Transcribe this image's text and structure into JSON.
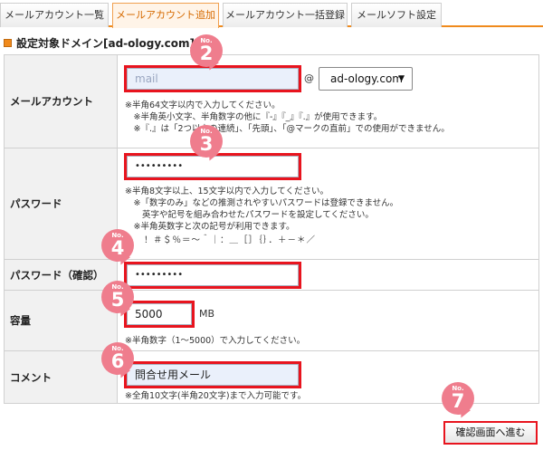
{
  "tabs": [
    {
      "label": "メールアカウント一覧",
      "active": false
    },
    {
      "label": "メールアカウント追加",
      "active": true
    },
    {
      "label": "メールアカウント一括登録",
      "active": false
    },
    {
      "label": "メールソフト設定",
      "active": false
    }
  ],
  "section_title": "設定対象ドメイン[ad-ology.com]",
  "account": {
    "label": "メールアカウント",
    "value": "mail",
    "at": "@",
    "domain": "ad-ology.com",
    "notes": [
      "※半角64文字以内で入力してください。",
      "　※半角英小文字、半角数字の他に『-』『_』『.』が使用できます。",
      "　※『.』は「2つ以上の連続」、「先頭」、「@マークの直前」での使用ができません。"
    ]
  },
  "password": {
    "label": "パスワード",
    "value": "•••••••••",
    "notes": [
      "※半角8文字以上、15文字以内で入力してください。",
      "　※「数字のみ」などの推測されやすいパスワードは登録できません。",
      "　　英字や記号を組み合わせたパスワードを設定してください。",
      "　※半角英数字と次の記号が利用できます。",
      "　　！＃＄％＝～＾｜：＿［］｛｝．＋－＊／"
    ]
  },
  "password_confirm": {
    "label": "パスワード（確認）",
    "value": "•••••••••"
  },
  "capacity": {
    "label": "容量",
    "value": "5000",
    "unit": "MB",
    "note": "※半角数字（1～5000）で入力してください。"
  },
  "comment": {
    "label": "コメント",
    "value": "問合せ用メール",
    "note": "※全角10文字(半角20文字)まで入力可能です。"
  },
  "submit_label": "確認画面へ進む",
  "badges": [
    {
      "no": "No.",
      "num": "2"
    },
    {
      "no": "No.",
      "num": "3"
    },
    {
      "no": "No.",
      "num": "4"
    },
    {
      "no": "No.",
      "num": "5"
    },
    {
      "no": "No.",
      "num": "6"
    },
    {
      "no": "No.",
      "num": "7"
    }
  ],
  "colors": {
    "accent": "#f08a1c",
    "highlight": "#e8141e",
    "badge": "#ef7d8d",
    "input_bg": "#eaf0fb"
  }
}
